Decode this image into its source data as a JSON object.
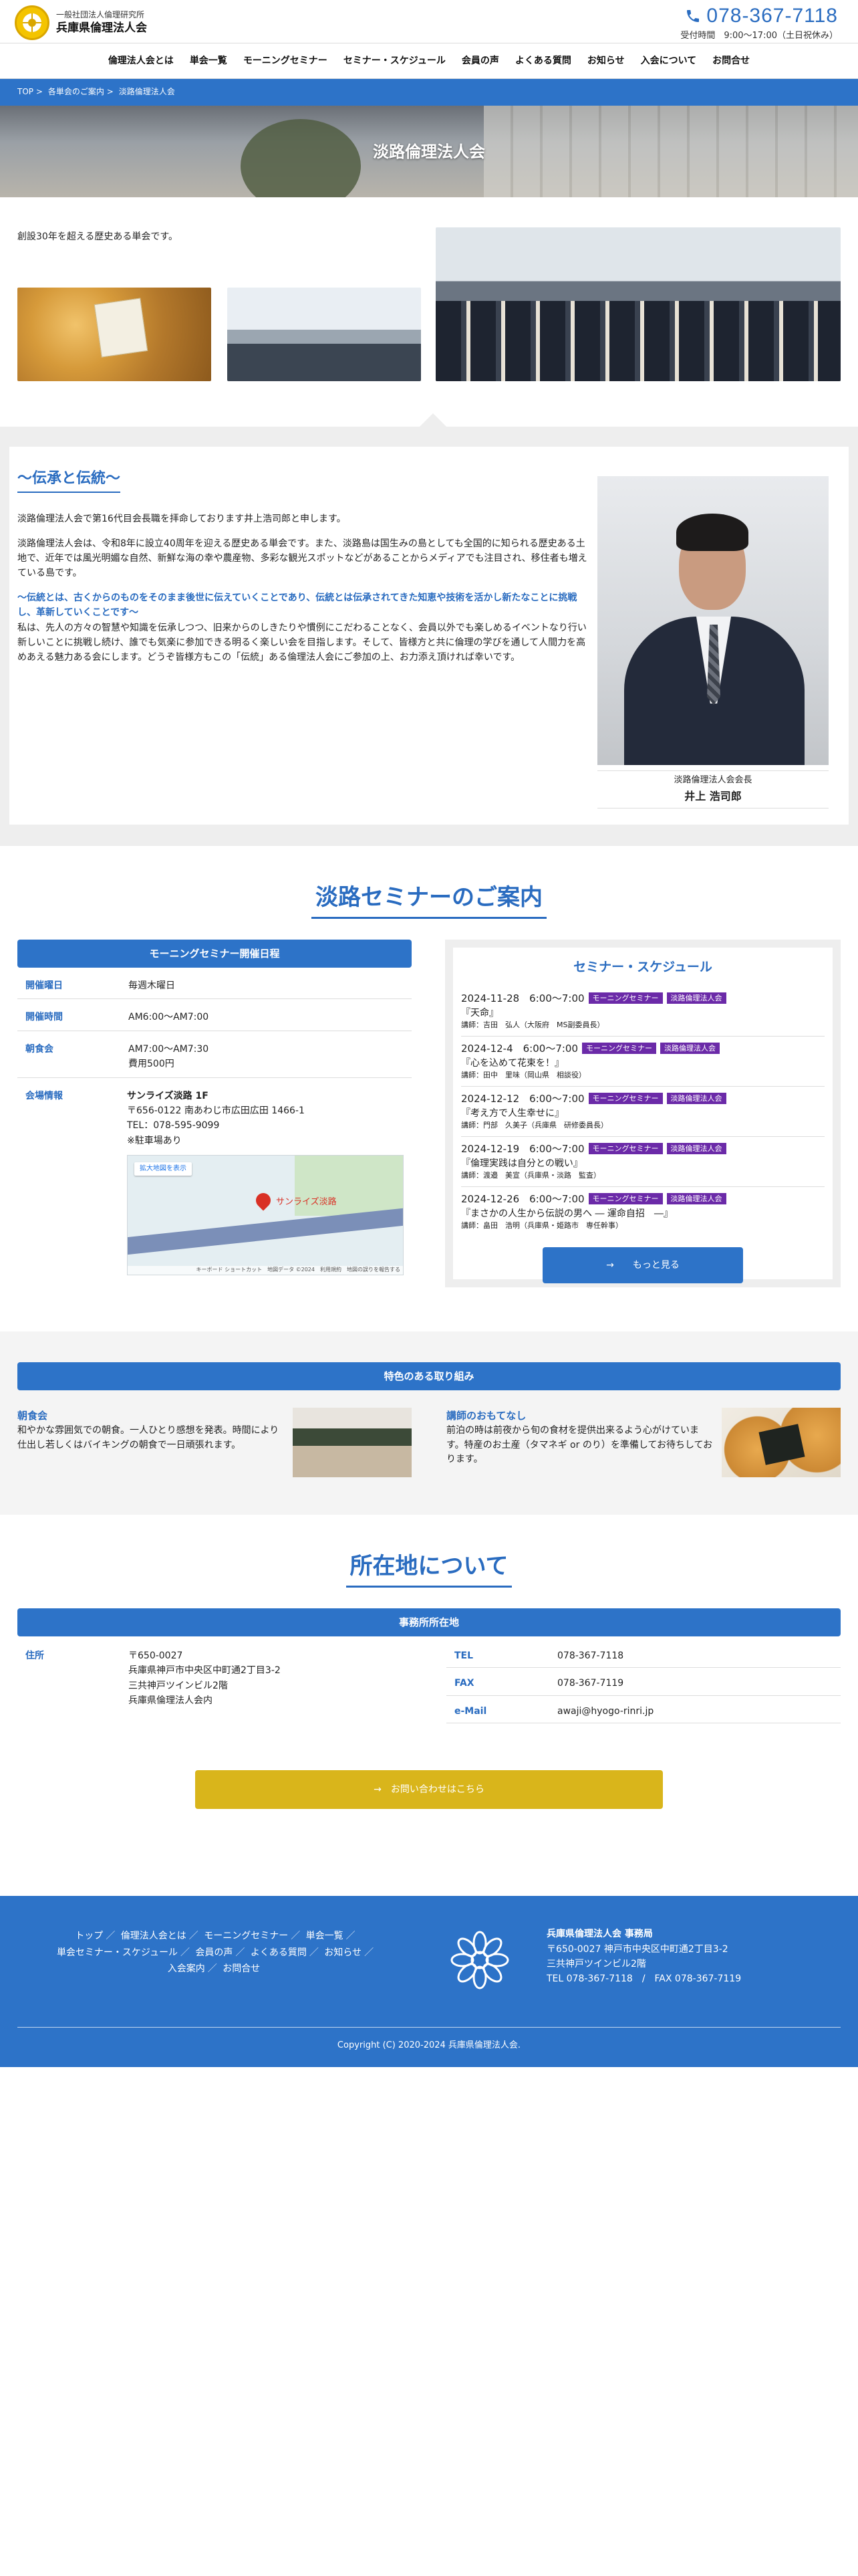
{
  "header": {
    "logo_sub": "一般社団法人倫理研究所",
    "logo_main": "兵庫県倫理法人会",
    "tel": "078-367-7118",
    "hours": "受付時間　9:00〜17:00（土日祝休み）"
  },
  "nav": [
    "倫理法人会とは",
    "単会一覧",
    "モーニングセミナー",
    "セミナー・スケジュール",
    "会員の声",
    "よくある質問",
    "お知らせ",
    "入会について",
    "お問合せ"
  ],
  "breadcrumb": [
    "TOP >",
    "各単会のご案内 >",
    "淡路倫理法人会"
  ],
  "hero": {
    "title": "淡路倫理法人会"
  },
  "intro": {
    "text": "創設30年を超える歴史ある単会です。"
  },
  "successor": {
    "heading": "〜伝承と伝統〜",
    "p1": "淡路倫理法人会で第16代目会長職を拝命しております井上浩司郎と申します。",
    "p2": "淡路倫理法人会は、令和8年に設立40周年を迎える歴史ある単会です。また、淡路島は国生みの島としても全国的に知られる歴史ある土地で、近年では風光明媚な自然、新鮮な海の幸や農産物、多彩な観光スポットなどがあることからメディアでも注目され、移住者も増えている島です。",
    "p3": "〜伝統とは、古くからのものをそのまま後世に伝えていくことであり、伝統とは伝承されてきた知恵や技術を活かし新たなことに挑戦し、革新していくことです〜",
    "p4": "私は、先人の方々の智慧や知識を伝承しつつ、旧来からのしきたりや慣例にこだわることなく、会員以外でも楽しめるイベントなり行い新しいことに挑戦し続け、誰でも気楽に参加できる明るく楽しい会を目指します。そして、皆様方と共に倫理の学びを通して人間力を高めあえる魅力ある会にします。どうぞ皆様方もこの「伝統」ある倫理法人会にご参加の上、お力添え頂ければ幸いです。",
    "caption_role": "淡路倫理法人会会長",
    "caption_name": "井上 浩司郎"
  },
  "seminar": {
    "title": "淡路セミナーのご案内",
    "box_title": "モーニングセミナー開催日程",
    "rows": [
      {
        "k": "開催曜日",
        "v": "毎週木曜日"
      },
      {
        "k": "開催時間",
        "v": "AM6:00〜AM7:00"
      },
      {
        "k": "朝食会",
        "v": "AM7:00〜AM7:30",
        "v2": "費用500円"
      }
    ],
    "venue_k": "会場情報",
    "venue_name": "サンライズ淡路 1F",
    "venue_addr": "〒656-0122 南あわじ市広田広田 1466-1",
    "venue_tel": "TEL：078-595-9099",
    "venue_parking": "※駐車場あり",
    "map": {
      "btn": "拡大地図を表示",
      "label": "サンライズ淡路",
      "foot": "キーボード ショートカット　地図データ ©2024　利用規約　地図の誤りを報告する"
    },
    "schedule_title": "セミナー・スケジュール",
    "schedule": [
      {
        "date": "2024-11-28　6:00〜7:00",
        "tags": [
          "モーニングセミナー",
          "淡路倫理法人会"
        ],
        "title": "『天命』",
        "lect": "講師：吉田　弘人（大阪府　MS副委員長）"
      },
      {
        "date": "2024-12-4　6:00〜7:00",
        "tags": [
          "モーニングセミナー",
          "淡路倫理法人会"
        ],
        "title": "『心を込めて花束を！』",
        "lect": "講師：田中　里味（岡山県　相談役）"
      },
      {
        "date": "2024-12-12　6:00〜7:00",
        "tags": [
          "モーニングセミナー",
          "淡路倫理法人会"
        ],
        "title": "『考え方で人生幸せに』",
        "lect": "講師：門部　久美子（兵庫県　研修委員長）"
      },
      {
        "date": "2024-12-19　6:00〜7:00",
        "tags": [
          "モーニングセミナー",
          "淡路倫理法人会"
        ],
        "title": "『倫理実践は自分との戦い』",
        "lect": "講師：渡邉　美宣（兵庫県・淡路　監査）"
      },
      {
        "date": "2024-12-26　6:00〜7:00",
        "tags": [
          "モーニングセミナー",
          "淡路倫理法人会"
        ],
        "title": "『まさかの人生から伝説の男へ ― 運命自招　―』",
        "lect": "講師：畠田　浩明（兵庫県・姫路市　専任幹事）"
      }
    ],
    "more": "→　　もっと見る"
  },
  "features": {
    "title": "特色のある取り組み",
    "items": [
      {
        "h": "朝食会",
        "p": "和やかな雰囲気での朝食。一人ひとり感想を発表。時間により仕出し若しくはバイキングの朝食で一日頑張れます。"
      },
      {
        "h": "講師のおもてなし",
        "p": "前泊の時は前夜から旬の食材を提供出来るよう心がけています。特産のお土産（タマネギ or のり）を準備してお待ちしております。"
      }
    ]
  },
  "location": {
    "title": "所在地について",
    "box_title": "事務所所在地",
    "addr_k": "住所",
    "addr": [
      "〒650-0027",
      "兵庫県神戸市中央区中町通2丁目3-2",
      "三共神戸ツインビル2階",
      "兵庫県倫理法人会内"
    ],
    "right": [
      {
        "k": "TEL",
        "v": "078-367-7118"
      },
      {
        "k": "FAX",
        "v": "078-367-7119"
      },
      {
        "k": "e-Mail",
        "v": "awaji@hyogo-rinri.jp"
      }
    ],
    "contact": "→　お問い合わせはこちら"
  },
  "footer": {
    "nav": [
      "トップ",
      "倫理法人会とは",
      "モーニングセミナー",
      "単会一覧",
      "単会セミナー・スケジュール",
      "会員の声",
      "よくある質問",
      "お知らせ",
      "入会案内",
      "お問合せ"
    ],
    "org": "兵庫県倫理法人会 事務局",
    "addr1": "〒650-0027 神戸市中央区中町通2丁目3-2",
    "addr2": "三共神戸ツインビル2階",
    "telfax": "TEL 078-367-7118　/　FAX 078-367-7119",
    "copy": "Copyright (C) 2020-2024 兵庫県倫理法人会."
  },
  "colors": {
    "primary": "#2d73c8",
    "accent": "#d9b51b",
    "badge": "#6b2aa8"
  }
}
